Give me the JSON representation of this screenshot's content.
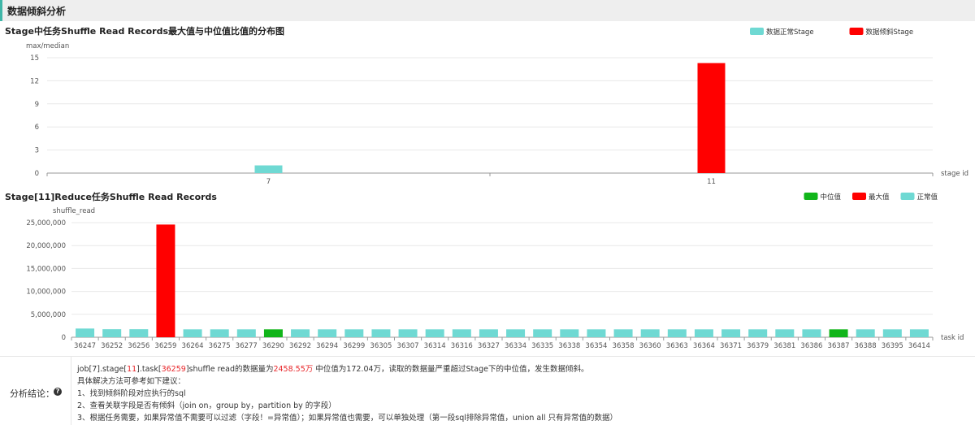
{
  "header": {
    "title": "数据倾斜分析"
  },
  "colors": {
    "normal": "#6fd9d3",
    "skew": "#ff0000",
    "median": "#11b51a"
  },
  "chart_data": [
    {
      "type": "bar",
      "title": "Stage中任务Shuffle Read Records最大值与中位值比值的分布图",
      "ylabel": "max/median",
      "xlabel": "stage id",
      "categories": [
        "7",
        "11"
      ],
      "ylim": [
        0,
        15
      ],
      "yticks": [
        0,
        3,
        6,
        9,
        12,
        15
      ],
      "series": [
        {
          "name": "数据正常Stage",
          "values": [
            1.0,
            null
          ]
        },
        {
          "name": "数据倾斜Stage",
          "values": [
            null,
            14.3
          ]
        }
      ],
      "legend": [
        "数据正常Stage",
        "数据倾斜Stage"
      ],
      "legend_position": "top-right",
      "grid": true
    },
    {
      "type": "bar",
      "title": "Stage[11]Reduce任务Shuffle Read Records",
      "ylabel": "shuffle_read",
      "xlabel": "task id",
      "ylim": [
        0,
        25000000
      ],
      "yticks": [
        0,
        5000000,
        10000000,
        15000000,
        20000000,
        25000000
      ],
      "ytick_labels": [
        "0",
        "5,000,000",
        "10,000,000",
        "15,000,000",
        "20,000,000",
        "25,000,000"
      ],
      "categories": [
        "36247",
        "36252",
        "36256",
        "36259",
        "36264",
        "36275",
        "36277",
        "36290",
        "36292",
        "36294",
        "36299",
        "36305",
        "36307",
        "36314",
        "36316",
        "36327",
        "36334",
        "36335",
        "36338",
        "36354",
        "36358",
        "36360",
        "36363",
        "36364",
        "36371",
        "36379",
        "36381",
        "36386",
        "36387",
        "36388",
        "36395",
        "36414"
      ],
      "values": [
        1900000,
        1750000,
        1750000,
        24585500,
        1720400,
        1720400,
        1720400,
        1720400,
        1720400,
        1720400,
        1720400,
        1720400,
        1720400,
        1720400,
        1720400,
        1720400,
        1720400,
        1720400,
        1720400,
        1720400,
        1720400,
        1720400,
        1720400,
        1720400,
        1720400,
        1720400,
        1720400,
        1720400,
        1720400,
        1720400,
        1720400,
        1720400
      ],
      "bar_kinds": [
        "normal",
        "normal",
        "normal",
        "max",
        "normal",
        "normal",
        "normal",
        "median",
        "normal",
        "normal",
        "normal",
        "normal",
        "normal",
        "normal",
        "normal",
        "normal",
        "normal",
        "normal",
        "normal",
        "normal",
        "normal",
        "normal",
        "normal",
        "normal",
        "normal",
        "normal",
        "normal",
        "normal",
        "median",
        "normal",
        "normal",
        "normal"
      ],
      "legend": [
        "中位值",
        "最大值",
        "正常值"
      ],
      "legend_position": "top-right",
      "grid": true
    }
  ],
  "conclusion": {
    "label": "分析结论：",
    "line1": {
      "p1": "job[",
      "job": "7",
      "p2": "].stage[",
      "stage": "11",
      "p3": "].task[",
      "task": "36259",
      "p4": "]shuffle read的数据量为",
      "amount": "2458.55万",
      "p5": " 中位值为172.04万，读取的数据量严重超过Stage下的中位值，发生数据倾斜。"
    },
    "lines": [
      "具体解决方法可参考如下建议：",
      "1、找到倾斜阶段对应执行的sql",
      "2、查看关联字段是否有倾斜（join on，group by，partition by 的字段）",
      "3、根据任务需要，如果异常值不需要可以过滤（字段！=异常值）；如果异常值也需要，可以单独处理（第一段sql排除异常值，union all 只有异常值的数据）"
    ]
  }
}
